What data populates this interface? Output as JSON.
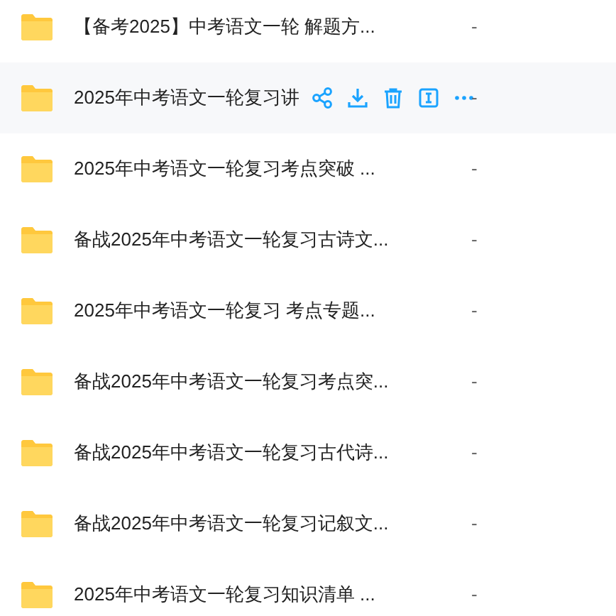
{
  "files": [
    {
      "name": "【备考2025】中考语文一轮 解题方...",
      "modified": "-",
      "hovered": false
    },
    {
      "name": "2025年中考语文一轮复习讲",
      "modified": "-",
      "hovered": true
    },
    {
      "name": "2025年中考语文一轮复习考点突破 ...",
      "modified": "-",
      "hovered": false
    },
    {
      "name": "备战2025年中考语文一轮复习古诗文...",
      "modified": "-",
      "hovered": false
    },
    {
      "name": "2025年中考语文一轮复习 考点专题...",
      "modified": "-",
      "hovered": false
    },
    {
      "name": "备战2025年中考语文一轮复习考点突...",
      "modified": "-",
      "hovered": false
    },
    {
      "name": "备战2025年中考语文一轮复习古代诗...",
      "modified": "-",
      "hovered": false
    },
    {
      "name": "备战2025年中考语文一轮复习记叙文...",
      "modified": "-",
      "hovered": false
    },
    {
      "name": "2025年中考语文一轮复习知识清单 ...",
      "modified": "-",
      "hovered": false
    }
  ]
}
